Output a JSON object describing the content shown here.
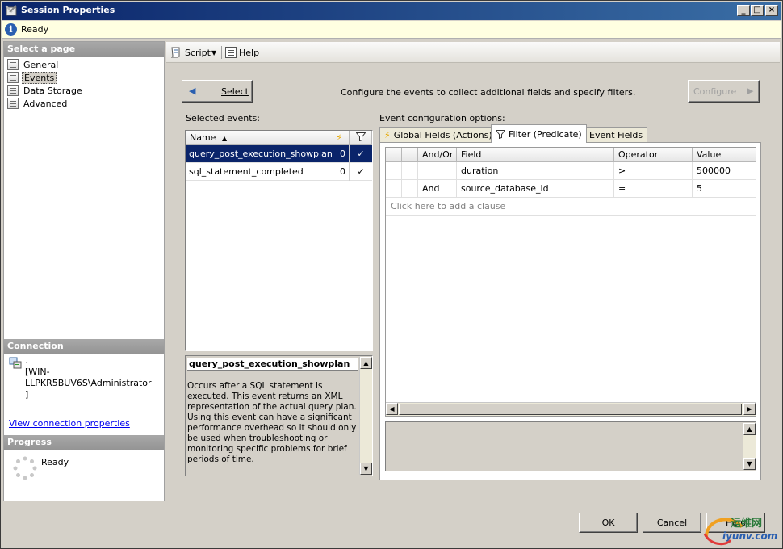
{
  "window": {
    "title": "Session Properties"
  },
  "status": {
    "text": "Ready"
  },
  "sidebar": {
    "header": "Select a page",
    "items": [
      {
        "label": "General",
        "selected": false
      },
      {
        "label": "Events",
        "selected": true
      },
      {
        "label": "Data Storage",
        "selected": false
      },
      {
        "label": "Advanced",
        "selected": false
      }
    ],
    "connection_header": "Connection",
    "connection_text": ".\n[WIN-LLPKR5BUV6S\\Administrator\n]",
    "connection_link": "View connection properties",
    "progress_header": "Progress",
    "progress_text": "Ready"
  },
  "toolbar": {
    "script_label": "Script",
    "help_label": "Help"
  },
  "main": {
    "select_button": "Select",
    "configure_text": "Configure the events to collect additional fields and specify filters.",
    "configure_button": "Configure",
    "selected_events_label": "Selected events:",
    "events_columns": [
      "Name"
    ],
    "events": [
      {
        "name": "query_post_execution_showplan",
        "count": "0",
        "selected": true
      },
      {
        "name": "sql_statement_completed",
        "count": "0",
        "selected": false
      }
    ],
    "description": {
      "title": "query_post_execution_showplan",
      "text": "Occurs after a SQL statement is executed. This event returns an XML representation of the actual query plan. Using this event can have a significant performance overhead so it should only be used when troubleshooting or monitoring specific problems for brief periods of time."
    },
    "config_options_label": "Event configuration options:",
    "tabs": [
      {
        "label": "Global Fields (Actions)",
        "icon": "lightning-icon",
        "active": false
      },
      {
        "label": "Filter (Predicate)",
        "icon": "funnel-icon",
        "active": true
      },
      {
        "label": "Event Fields",
        "icon": "",
        "active": false
      }
    ],
    "predicate_columns": [
      "And/Or",
      "Field",
      "Operator",
      "Value"
    ],
    "predicates": [
      {
        "andor": "",
        "field": "duration",
        "operator": ">",
        "value": "500000"
      },
      {
        "andor": "And",
        "field": "source_database_id",
        "operator": "=",
        "value": "5"
      }
    ],
    "add_clause_placeholder": "Click here to add a clause"
  },
  "footer": {
    "ok_label": "OK",
    "cancel_label": "Cancel",
    "help_label": "Help"
  },
  "watermark": {
    "line1": "运维网",
    "line2": "iyunv.com"
  },
  "colors": {
    "title_start": "#0a246a",
    "title_end": "#3a6ea5",
    "selection": "#0a246a",
    "link": "#0000ee"
  }
}
